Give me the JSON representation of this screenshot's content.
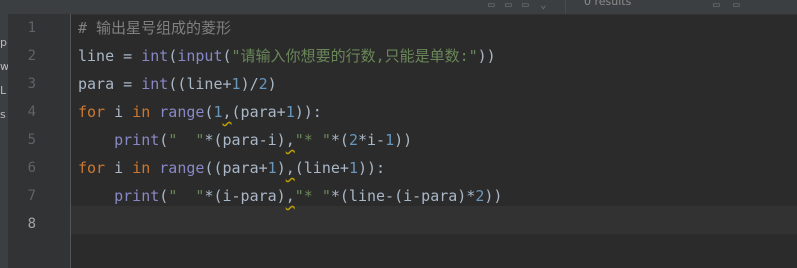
{
  "search": {
    "results_text": "0 results"
  },
  "side_panel": {
    "fragments": [
      "p",
      "w",
      "L",
      "s"
    ]
  },
  "editor": {
    "line_numbers": [
      "1",
      "2",
      "3",
      "4",
      "5",
      "6",
      "7",
      "8"
    ],
    "current_line": "8",
    "lines": [
      {
        "tokens": [
          [
            "cmt",
            "# 输出星号组成的菱形"
          ]
        ]
      },
      {
        "tokens": [
          [
            "",
            "line = "
          ],
          [
            "bi",
            "int"
          ],
          [
            "",
            "("
          ],
          [
            "bi",
            "input"
          ],
          [
            "",
            "("
          ],
          [
            "str",
            "\"请输入你想要的行数,只能是单数:\""
          ],
          [
            "",
            "))"
          ]
        ]
      },
      {
        "tokens": [
          [
            "",
            "para = "
          ],
          [
            "bi",
            "int"
          ],
          [
            "",
            "((line+"
          ],
          [
            "num",
            "1"
          ],
          [
            "",
            ")/"
          ],
          [
            "num",
            "2"
          ],
          [
            "",
            ")"
          ]
        ]
      },
      {
        "tokens": [
          [
            "kw",
            "for"
          ],
          [
            "",
            " i "
          ],
          [
            "kw",
            "in"
          ],
          [
            "",
            " "
          ],
          [
            "bi",
            "range"
          ],
          [
            "",
            "("
          ],
          [
            "num",
            "1"
          ],
          [
            "wavy",
            ","
          ],
          [
            "",
            "(para+"
          ],
          [
            "num",
            "1"
          ],
          [
            "",
            ")):"
          ]
        ]
      },
      {
        "tokens": [
          [
            "",
            "    "
          ],
          [
            "bi",
            "print"
          ],
          [
            "",
            "("
          ],
          [
            "str",
            "\"  \""
          ],
          [
            "",
            "*(para-i)"
          ],
          [
            "wavy",
            ","
          ],
          [
            "str",
            "\"* \""
          ],
          [
            "",
            "*("
          ],
          [
            "num",
            "2"
          ],
          [
            "",
            "*i-"
          ],
          [
            "num",
            "1"
          ],
          [
            "",
            "))"
          ]
        ]
      },
      {
        "tokens": [
          [
            "kw",
            "for"
          ],
          [
            "",
            " i "
          ],
          [
            "kw",
            "in"
          ],
          [
            "",
            " "
          ],
          [
            "bi",
            "range"
          ],
          [
            "",
            "((para+"
          ],
          [
            "num",
            "1"
          ],
          [
            "",
            ")"
          ],
          [
            "wavy",
            ","
          ],
          [
            "",
            "(line+"
          ],
          [
            "num",
            "1"
          ],
          [
            "",
            ")):"
          ]
        ]
      },
      {
        "tokens": [
          [
            "",
            "    "
          ],
          [
            "bi",
            "print"
          ],
          [
            "",
            "("
          ],
          [
            "str",
            "\"  \""
          ],
          [
            "",
            "*(i-para)"
          ],
          [
            "wavy",
            ","
          ],
          [
            "str",
            "\"* \""
          ],
          [
            "",
            "*(line-(i-para)*"
          ],
          [
            "num",
            "2"
          ],
          [
            "",
            "))"
          ]
        ]
      },
      {
        "tokens": []
      }
    ]
  }
}
